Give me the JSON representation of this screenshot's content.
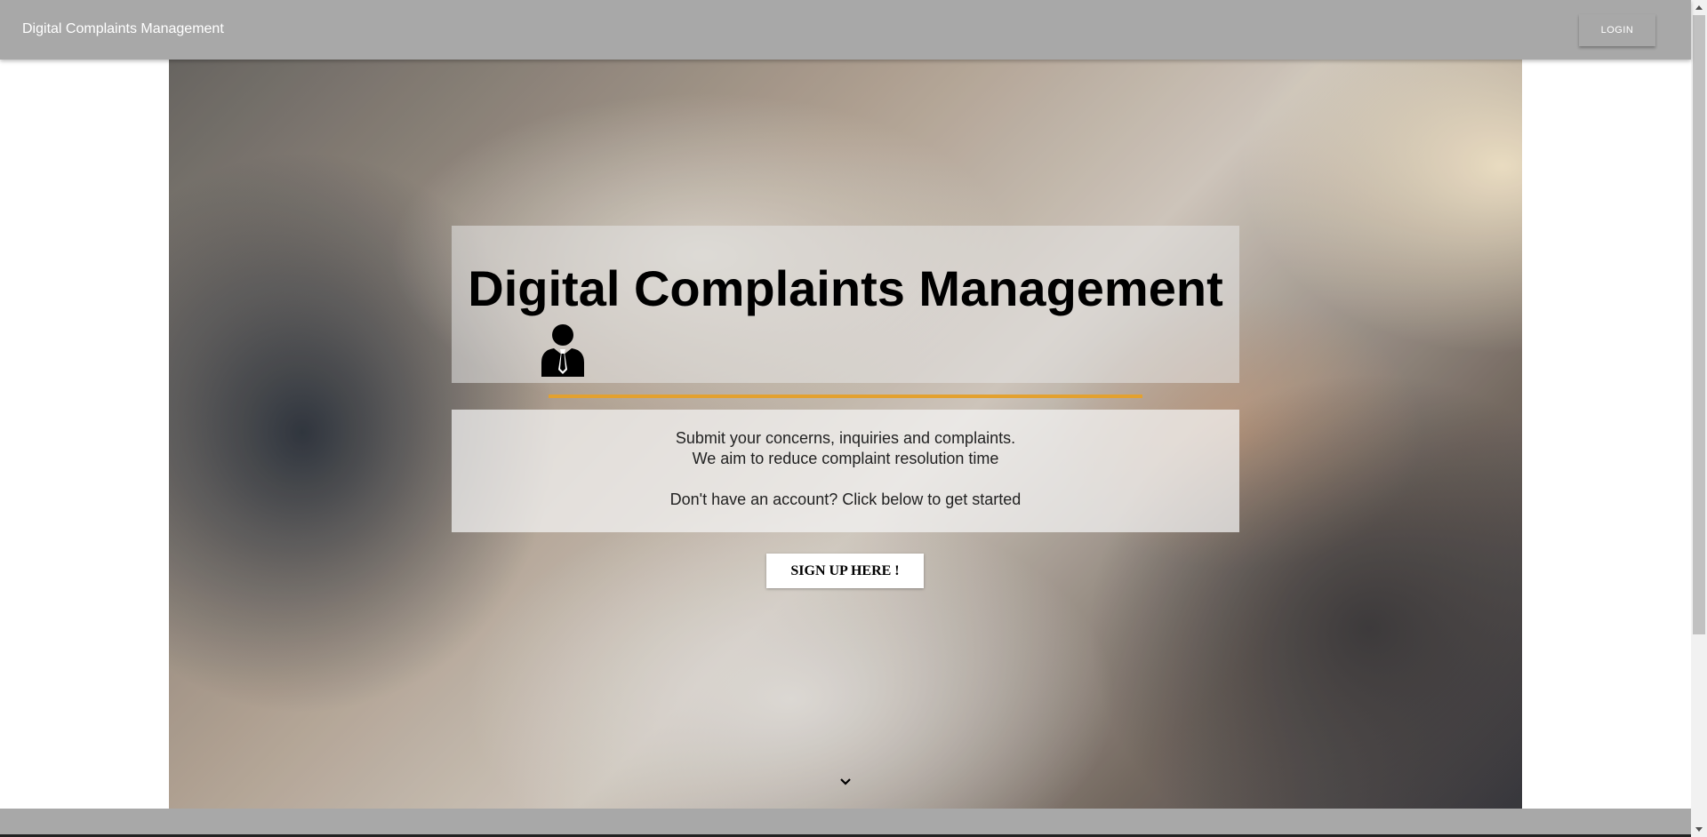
{
  "header": {
    "app_title": "Digital Complaints Management",
    "login_label": "LOGIN"
  },
  "hero": {
    "title": "Digital Complaints Management",
    "title_icon": "user-tie-icon",
    "accent_color": "#e3a12f",
    "lines": [
      "Submit your concerns, inquiries and complaints.",
      "We aim to reduce complaint resolution time",
      "Don't have an account? Click below to get started"
    ],
    "signup_label": "SIGN UP HERE !",
    "scroll_icon": "chevron-down-icon"
  },
  "colors": {
    "bar_background": "#a8a8a8",
    "panel_text": "#222222"
  }
}
